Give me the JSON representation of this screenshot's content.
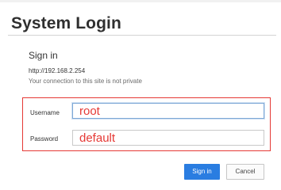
{
  "page": {
    "title": "System Login"
  },
  "dialog": {
    "heading": "Sign in",
    "url": "http://192.168.2.254",
    "note": "Your connection to this site is not private",
    "fields": {
      "username": {
        "label": "Username",
        "value": "root"
      },
      "password": {
        "label": "Password",
        "value": "default"
      }
    },
    "buttons": {
      "sign_in": "Sign in",
      "cancel": "Cancel"
    }
  },
  "colors": {
    "highlight": "#e53935",
    "primary_button": "#2a7de1",
    "entered_text": "#e53935"
  }
}
